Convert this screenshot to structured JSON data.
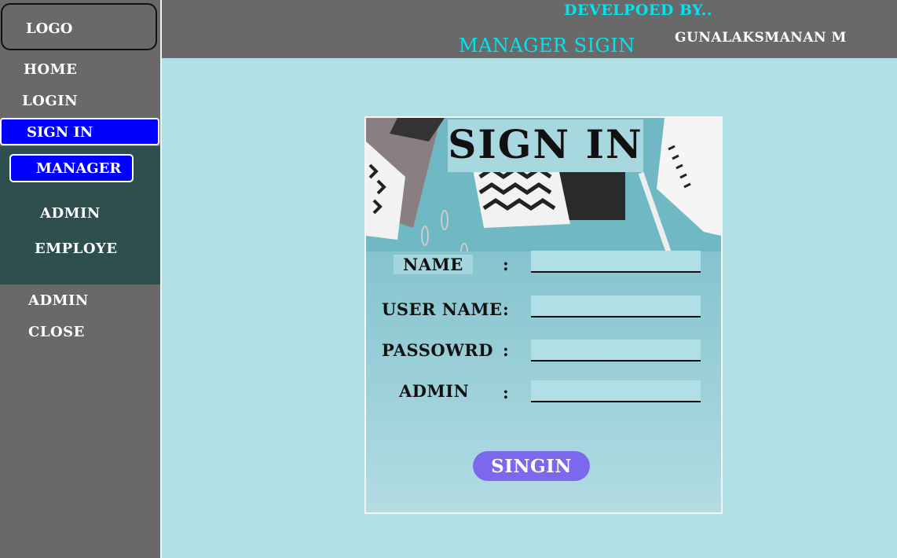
{
  "sidebar": {
    "logo": "LOGO",
    "items": [
      {
        "label": "HOME"
      },
      {
        "label": "LOGIN"
      },
      {
        "label": "SIGN IN"
      }
    ],
    "submenu": [
      {
        "label": "MANAGER"
      },
      {
        "label": "ADMIN"
      },
      {
        "label": "EMPLOYE"
      }
    ],
    "bottom": [
      {
        "label": "ADMIN"
      },
      {
        "label": "CLOSE"
      }
    ]
  },
  "header": {
    "developed_by": "DEVELPOED BY..",
    "developer": "GUNALAKSMANAN M",
    "page_title": "MANAGER SIGIN"
  },
  "form": {
    "title": "SIGN IN",
    "fields": [
      {
        "label": "NAME",
        "value": ""
      },
      {
        "label": "USER NAME",
        "value": ""
      },
      {
        "label": "PASSOWRD",
        "value": ""
      },
      {
        "label": "ADMIN",
        "value": ""
      }
    ],
    "colon": ":",
    "submit": "SINGIN"
  },
  "colors": {
    "background": "#b0dfe5",
    "panel": "#696969",
    "active": "#0000ff",
    "submenu": "#2f4f4f",
    "accent_cyan": "#00e5ee",
    "button": "#7b68ee"
  }
}
